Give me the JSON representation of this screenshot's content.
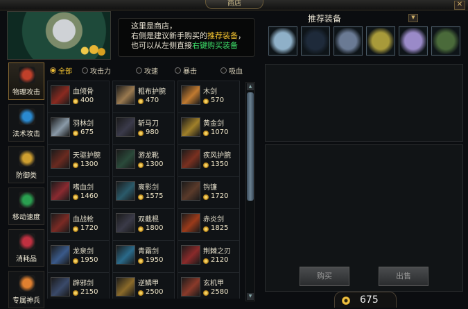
{
  "window": {
    "title": "商店",
    "close_label": "✕"
  },
  "hint": {
    "line1": "这里是商店，",
    "line2_pre": "右侧是建议新手购买的",
    "line2_hl": "推荐装备",
    "line2_post": "，",
    "line3_pre": "也可以从左侧直接",
    "line3_hl": "右键购买装备"
  },
  "recommended": {
    "title": "推荐装备",
    "dropdown_icon": "▼",
    "items": [
      {
        "icon": "fan-icon",
        "color": "#8fb0c8"
      },
      {
        "icon": "boots-icon",
        "color": "#1e2a3a"
      },
      {
        "icon": "gauntlet-icon",
        "color": "#6a7a94"
      },
      {
        "icon": "sword-icon",
        "color": "#a89a3a"
      },
      {
        "icon": "skull-icon",
        "color": "#9a8ac8"
      },
      {
        "icon": "orb-icon",
        "color": "#4a6a3a"
      }
    ]
  },
  "categories": [
    {
      "label": "物理攻击",
      "icon": "dagger-icon",
      "color": "#c0402a",
      "active": true
    },
    {
      "label": "法术攻击",
      "icon": "magic-orb-icon",
      "color": "#2a8ad0",
      "active": false
    },
    {
      "label": "防御类",
      "icon": "shield-icon",
      "color": "#d0a030",
      "active": false
    },
    {
      "label": "移动速度",
      "icon": "boot-icon",
      "color": "#2aa050",
      "active": false
    },
    {
      "label": "消耗品",
      "icon": "potion-icon",
      "color": "#c03040",
      "active": false
    },
    {
      "label": "专属神兵",
      "icon": "star-icon",
      "color": "#e08030",
      "active": false
    }
  ],
  "filters": [
    {
      "label": "全部",
      "on": true
    },
    {
      "label": "攻击力",
      "on": false
    },
    {
      "label": "攻速",
      "on": false
    },
    {
      "label": "暴击",
      "on": false
    },
    {
      "label": "吸血",
      "on": false
    }
  ],
  "items": [
    {
      "name": "血倾骨",
      "price": "400",
      "icon": "skull-red-icon",
      "color": "#8a2a20"
    },
    {
      "name": "粗布护腕",
      "price": "470",
      "icon": "bracer-icon",
      "color": "#9a7a50"
    },
    {
      "name": "木剑",
      "price": "570",
      "icon": "wood-sword-icon",
      "color": "#c07a30"
    },
    {
      "name": "羽林剑",
      "price": "675",
      "icon": "sword-icon",
      "color": "#8a9aa8"
    },
    {
      "name": "斩马刀",
      "price": "980",
      "icon": "blade-icon",
      "color": "#3a3a4a"
    },
    {
      "name": "黄金剑",
      "price": "1070",
      "icon": "gold-sword-icon",
      "color": "#a0802a"
    },
    {
      "name": "天驱护腕",
      "price": "1300",
      "icon": "bracer-icon",
      "color": "#6a2a20"
    },
    {
      "name": "游龙靴",
      "price": "1300",
      "icon": "boots-icon",
      "color": "#2a4a3a"
    },
    {
      "name": "疾风护腕",
      "price": "1350",
      "icon": "bracer-icon",
      "color": "#7a3020"
    },
    {
      "name": "嗜血剑",
      "price": "1460",
      "icon": "blood-sword-icon",
      "color": "#8a2a30"
    },
    {
      "name": "离影剑",
      "price": "1575",
      "icon": "shadow-sword-icon",
      "color": "#2a5a6a"
    },
    {
      "name": "钩镰",
      "price": "1720",
      "icon": "sickle-icon",
      "color": "#5a3a2a"
    },
    {
      "name": "血战枪",
      "price": "1720",
      "icon": "spear-icon",
      "color": "#7a2a24"
    },
    {
      "name": "双截棍",
      "price": "1800",
      "icon": "nunchaku-icon",
      "color": "#3a3a48"
    },
    {
      "name": "赤炎剑",
      "price": "1825",
      "icon": "flame-sword-icon",
      "color": "#9a3a1a"
    },
    {
      "name": "龙泉剑",
      "price": "1950",
      "icon": "dragon-sword-icon",
      "color": "#3a5a8a"
    },
    {
      "name": "青霜剑",
      "price": "1950",
      "icon": "frost-sword-icon",
      "color": "#2a6a8a"
    },
    {
      "name": "荆棘之刃",
      "price": "2120",
      "icon": "thorn-blade-icon",
      "color": "#8a2a2a"
    },
    {
      "name": "辟邪剑",
      "price": "2150",
      "icon": "sword-icon",
      "color": "#3a4a6a"
    },
    {
      "name": "逆鳞甲",
      "price": "2500",
      "icon": "armor-icon",
      "color": "#8a6a2a"
    },
    {
      "name": "玄机甲",
      "price": "2580",
      "icon": "armor-icon",
      "color": "#8a3a2a"
    }
  ],
  "buttons": {
    "buy": "购买",
    "sell": "出售"
  },
  "gold": {
    "amount": "675",
    "icon": "coin-icon"
  }
}
